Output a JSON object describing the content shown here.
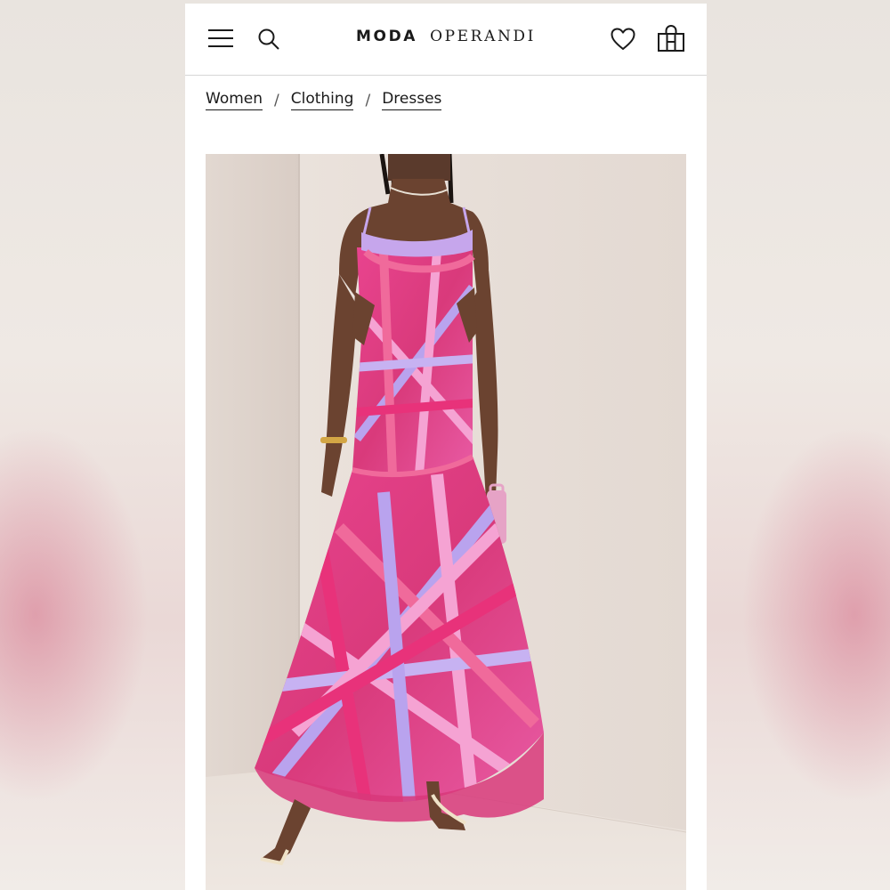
{
  "app": {
    "logo_part1": "MODA",
    "logo_part2": "OPERANDI"
  },
  "header": {
    "icons": [
      "menu-icon",
      "search-icon",
      "heart-icon",
      "shopping-bag-icon"
    ]
  },
  "breadcrumb": {
    "items": [
      {
        "label": "Women"
      },
      {
        "label": "Clothing"
      },
      {
        "label": "Dresses"
      }
    ],
    "separator": "/"
  },
  "product_image": {
    "subject": "model-wearing-dress"
  }
}
